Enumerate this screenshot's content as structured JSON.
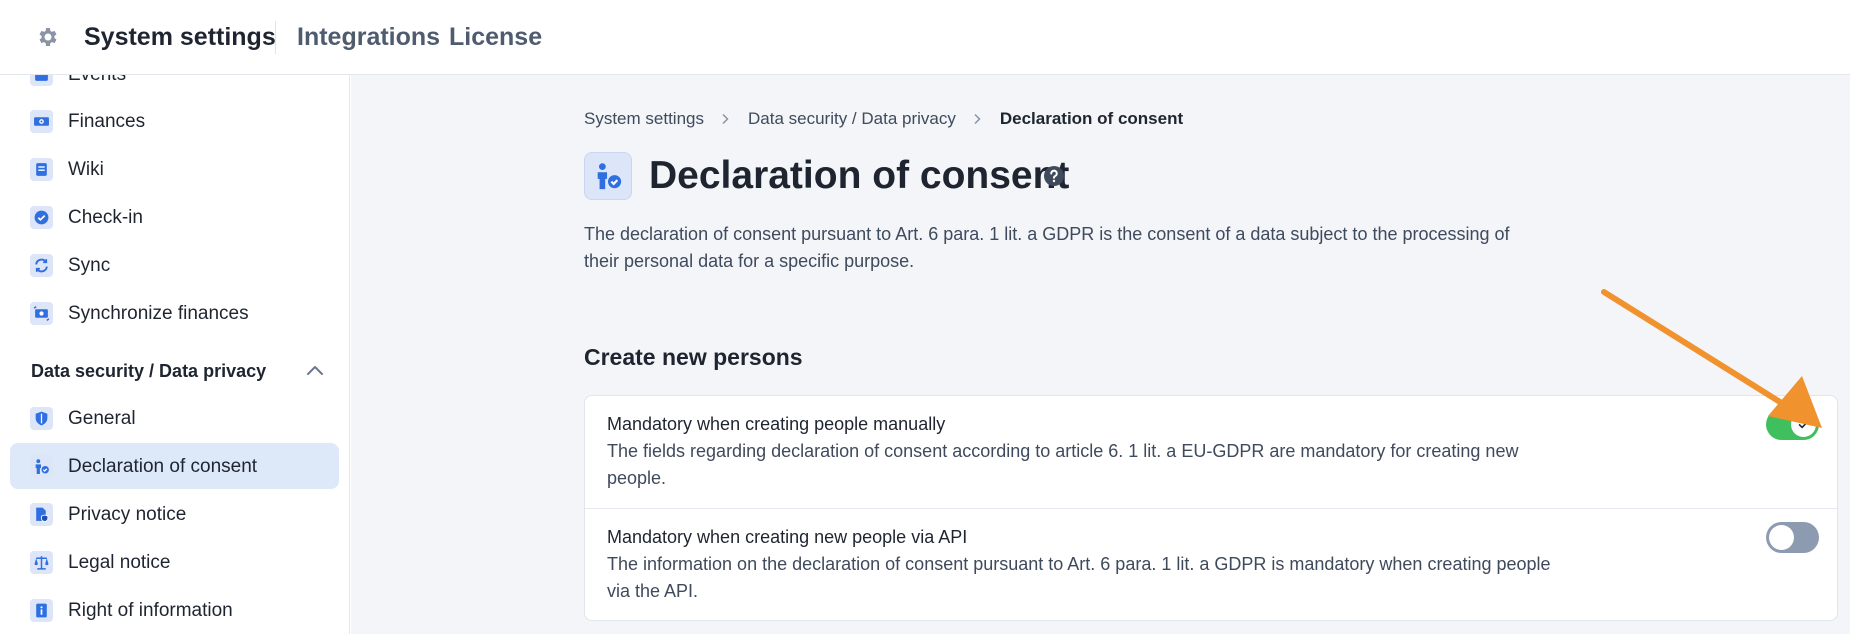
{
  "topbar": {
    "title": "System settings",
    "links": [
      "Integrations",
      "License"
    ]
  },
  "sidebar": {
    "items_top": [
      {
        "label": "Events",
        "icon": "calendar-icon"
      },
      {
        "label": "Finances",
        "icon": "banknote-icon"
      },
      {
        "label": "Wiki",
        "icon": "book-icon"
      },
      {
        "label": "Check-in",
        "icon": "check-circle-icon"
      },
      {
        "label": "Sync",
        "icon": "sync-icon"
      },
      {
        "label": "Synchronize finances",
        "icon": "banknote-sync-icon"
      }
    ],
    "section_title": "Data security / Data privacy",
    "items_section": [
      {
        "label": "General",
        "icon": "shield-icon"
      },
      {
        "label": "Declaration of consent",
        "icon": "person-check-icon",
        "active": true
      },
      {
        "label": "Privacy notice",
        "icon": "document-shield-icon"
      },
      {
        "label": "Legal notice",
        "icon": "scales-icon"
      },
      {
        "label": "Right of information",
        "icon": "info-document-icon"
      }
    ]
  },
  "breadcrumb": [
    "System settings",
    "Data security / Data privacy",
    "Declaration of consent"
  ],
  "page": {
    "title": "Declaration of consent",
    "description": "The declaration of consent pursuant to Art. 6 para. 1 lit. a GDPR is the consent of a data subject to the processing of their personal data for a specific purpose."
  },
  "section": {
    "title": "Create new persons",
    "settings": [
      {
        "title": "Mandatory when creating people manually",
        "description": "The fields regarding declaration of consent according to article 6. 1 lit. a EU-GDPR are mandatory for creating new people.",
        "enabled": true
      },
      {
        "title": "Mandatory when creating new people via API",
        "description": "The information on the declaration of consent pursuant to Art. 6 para. 1 lit. a GDPR is mandatory when creating people via the API.",
        "enabled": false
      }
    ]
  },
  "colors": {
    "accent": "#2f6fe0",
    "toggle_on": "#3fbf5e",
    "toggle_off": "#8d9bb0",
    "annotation_arrow": "#f0922e",
    "active_item_bg": "#dde8f9"
  }
}
